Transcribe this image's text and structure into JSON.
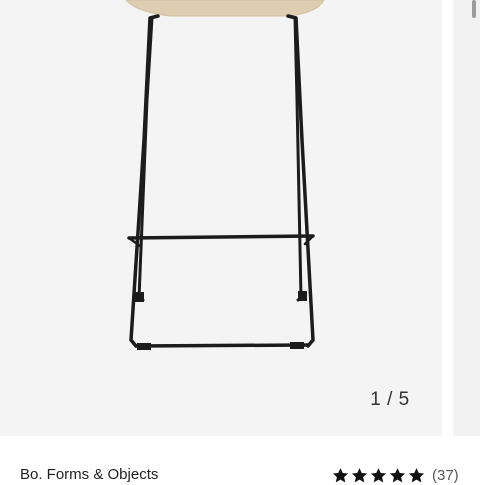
{
  "gallery": {
    "current_index": "1 / 5",
    "image_icon": "bar-stool-image"
  },
  "product": {
    "brand": "Bo. Forms & Objects",
    "rating": 5,
    "rating_max": 5,
    "review_count": "(37)"
  },
  "colors": {
    "image_background": "#f4f4f4",
    "seat": "#dfcdb2",
    "frame": "#1c1c1c",
    "star": "#111111"
  }
}
